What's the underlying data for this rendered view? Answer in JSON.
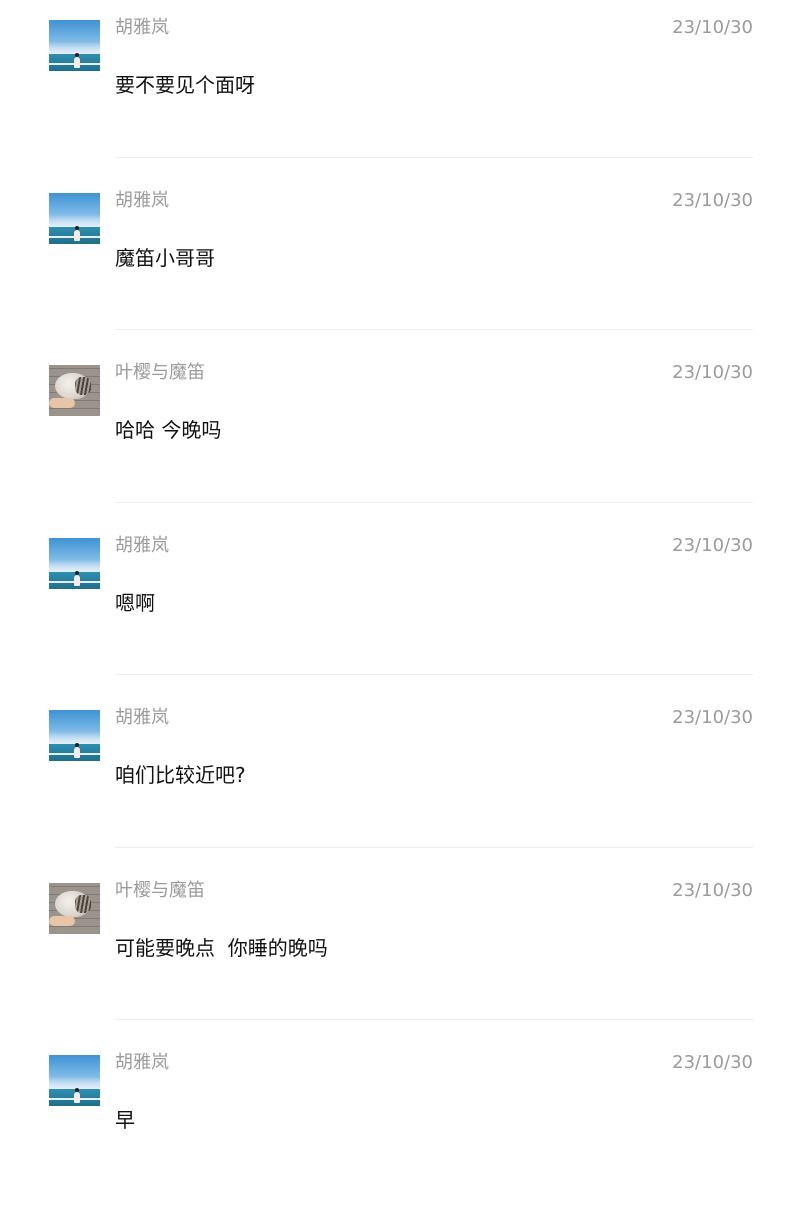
{
  "messages": [
    {
      "sender": "胡雅岚",
      "avatar": "sea-avatar",
      "time": "23/10/30",
      "text": "要不要见个面呀"
    },
    {
      "sender": "胡雅岚",
      "avatar": "sea-avatar",
      "time": "23/10/30",
      "text": "魔笛小哥哥"
    },
    {
      "sender": "叶樱与魔笛",
      "avatar": "cat-avatar",
      "time": "23/10/30",
      "text": "哈哈 今晚吗"
    },
    {
      "sender": "胡雅岚",
      "avatar": "sea-avatar",
      "time": "23/10/30",
      "text": "嗯啊"
    },
    {
      "sender": "胡雅岚",
      "avatar": "sea-avatar",
      "time": "23/10/30",
      "text": "咱们比较近吧?"
    },
    {
      "sender": "叶樱与魔笛",
      "avatar": "cat-avatar",
      "time": "23/10/30",
      "text": "可能要晚点  你睡的晚吗"
    },
    {
      "sender": "胡雅岚",
      "avatar": "sea-avatar",
      "time": "23/10/30",
      "text": "早"
    }
  ]
}
